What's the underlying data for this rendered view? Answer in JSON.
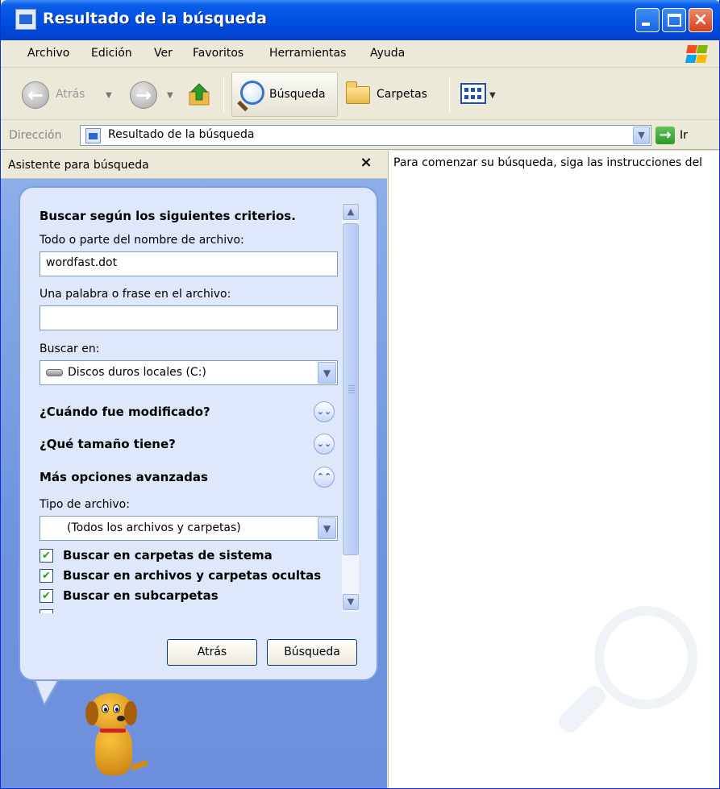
{
  "window": {
    "title": "Resultado de la búsqueda"
  },
  "menu": {
    "items": [
      "Archivo",
      "Edición",
      "Ver",
      "Favoritos",
      "Herramientas",
      "Ayuda"
    ]
  },
  "toolbar": {
    "back_label": "Atrás",
    "search_label": "Búsqueda",
    "folders_label": "Carpetas"
  },
  "address": {
    "label": "Dirección",
    "value": "Resultado de la búsqueda",
    "go_label": "Ir"
  },
  "search_pane": {
    "title": "Asistente para búsqueda",
    "close_glyph": "×",
    "criteria_title": "Buscar según los siguientes criterios.",
    "filename_label": "Todo o parte del nombre de archivo:",
    "filename_value": "wordfast.dot",
    "phrase_label": "Una palabra o frase en el archivo:",
    "phrase_value": "",
    "look_in_label": "Buscar en:",
    "look_in_value": "Discos duros locales (C:)",
    "when_modified": "¿Cuándo fue modificado?",
    "what_size": "¿Qué tamaño tiene?",
    "more_options": "Más opciones avanzadas",
    "file_type_label": "Tipo de archivo:",
    "file_type_value": "(Todos los archivos y carpetas)",
    "checkboxes": [
      {
        "label": "Buscar en carpetas de sistema",
        "checked": true
      },
      {
        "label": "Buscar en archivos y carpetas ocultas",
        "checked": true
      },
      {
        "label": "Buscar en subcarpetas",
        "checked": true
      }
    ],
    "back_button": "Atrás",
    "search_button": "Búsqueda"
  },
  "results_pane": {
    "text": "Para comenzar su búsqueda, siga las instrucciones del"
  },
  "icons": {
    "checkmark": "✔",
    "chevron_down": "▼",
    "expand": "»",
    "arrow_up": "▲",
    "arrow_down": "▼",
    "close": "×"
  },
  "colors": {
    "titlebar": "#0050e0",
    "pane_background": "#7b9de4",
    "balloon": "#dfe7fb"
  }
}
